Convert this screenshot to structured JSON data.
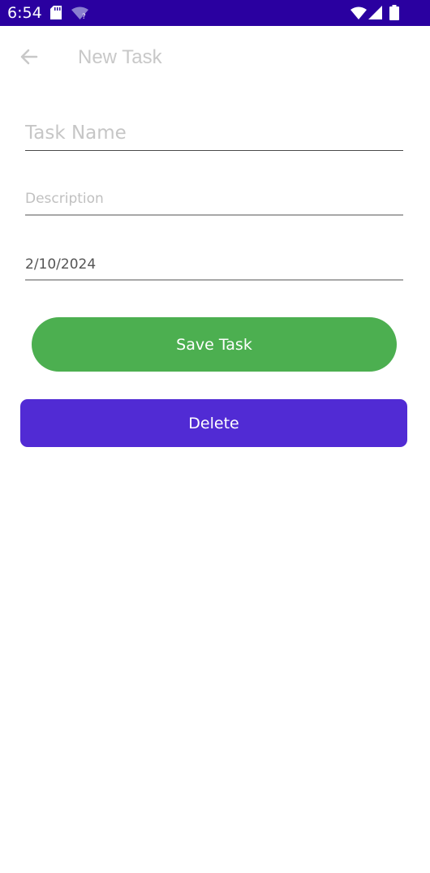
{
  "status_bar": {
    "time": "6:54",
    "background": "#2a00a0",
    "icons": [
      "sd-card-icon",
      "wifi-unknown-icon",
      "wifi-icon",
      "cell-signal-icon",
      "battery-icon"
    ]
  },
  "toolbar": {
    "back_icon": "arrow-left-icon",
    "title": "New Task"
  },
  "form": {
    "task_name": {
      "value": "",
      "placeholder": "Task Name"
    },
    "description": {
      "value": "",
      "placeholder": "Description"
    },
    "date": {
      "value": "2/10/2024"
    }
  },
  "actions": {
    "save_label": "Save Task",
    "save_color": "#4caf50",
    "delete_label": "Delete",
    "delete_color": "#512bd4"
  }
}
